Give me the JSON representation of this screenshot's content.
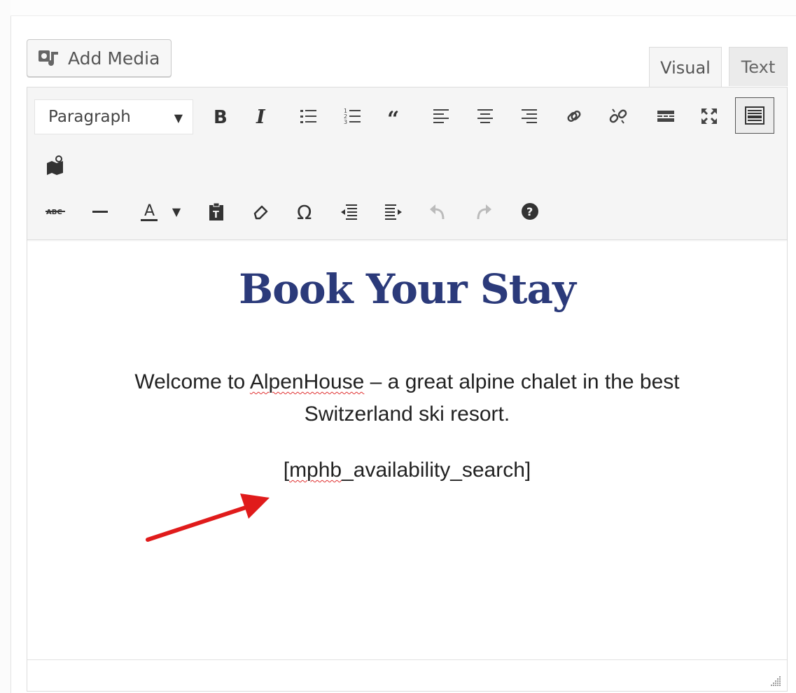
{
  "add_media": {
    "label": "Add Media",
    "icon": "add-media-icon"
  },
  "tabs": [
    {
      "label": "Visual",
      "active": true
    },
    {
      "label": "Text",
      "active": false
    }
  ],
  "toolbar": {
    "format_select": {
      "value": "Paragraph"
    },
    "row1": [
      "bold",
      "italic",
      "bulleted-list",
      "numbered-list",
      "blockquote",
      "align-left",
      "align-center",
      "align-right",
      "insert-link",
      "remove-link",
      "read-more",
      "fullscreen",
      "toolbar-toggle",
      "map-icon"
    ],
    "row2": [
      "strikethrough",
      "horizontal-line",
      "text-color",
      "paste-as-text",
      "clear-formatting",
      "special-character",
      "decrease-indent",
      "increase-indent",
      "undo",
      "redo",
      "help"
    ],
    "text_color_letter": "A"
  },
  "content": {
    "heading": "Book Your Stay",
    "welcome_before": "Welcome to ",
    "welcome_brand": "AlpenHouse",
    "welcome_after": " – a great alpine chalet in the best Switzerland ski resort.",
    "shortcode_open": "[",
    "shortcode_name": "mphb",
    "shortcode_rest": "_availability_search]"
  },
  "colors": {
    "heading": "#2b3a7a",
    "arrow": "#e01b1b",
    "spellcheck": "#e03030"
  }
}
